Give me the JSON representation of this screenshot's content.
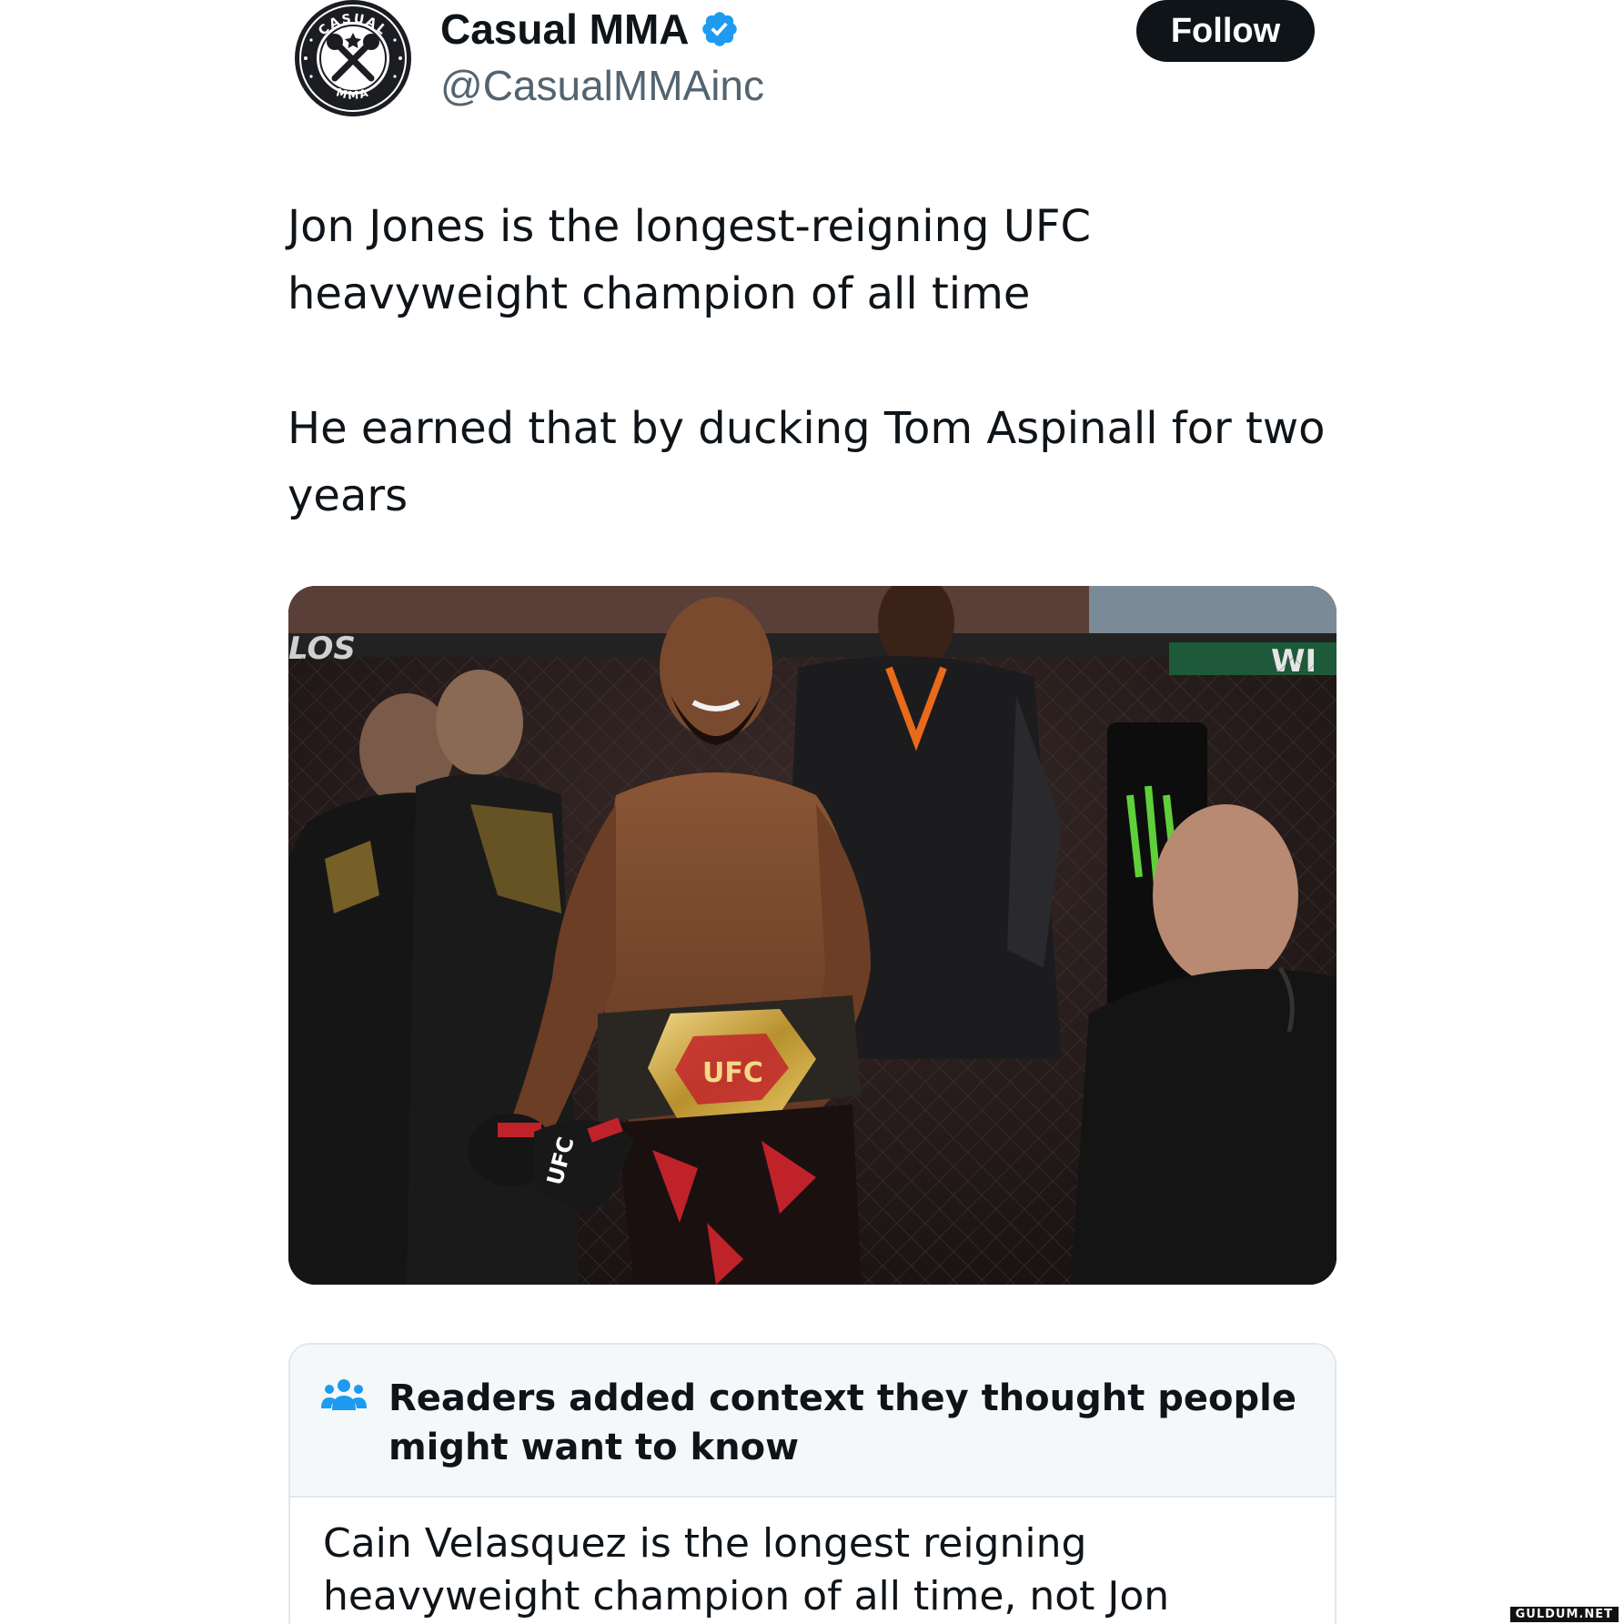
{
  "author": {
    "display_name": "Casual MMA",
    "handle": "@CasualMMAinc",
    "verified": true,
    "avatar_logo_text_top": "CASUAL",
    "avatar_logo_text_bottom": "MMA",
    "follow_label": "Follow"
  },
  "tweet": {
    "paragraph1": "Jon Jones is the longest-reigning UFC heavyweight champion of all time",
    "paragraph2": "He earned that by ducking Tom Aspinall for two years"
  },
  "media": {
    "has_photo": true,
    "photo_text_shorts": "UFC"
  },
  "community_note": {
    "icon": "people-icon",
    "title": "Readers added context they thought people might want to know",
    "body": "Cain Velasquez is the longest reigning heavyweight champion of all time, not Jon Jones."
  },
  "watermark": "GULDUM.NET",
  "colors": {
    "text_primary": "#0f1419",
    "text_secondary": "#536471",
    "verified_blue": "#1d9bf0",
    "follow_bg": "#0f1419",
    "note_header_bg": "#f4f8fa",
    "note_border": "#e1e8ed"
  }
}
